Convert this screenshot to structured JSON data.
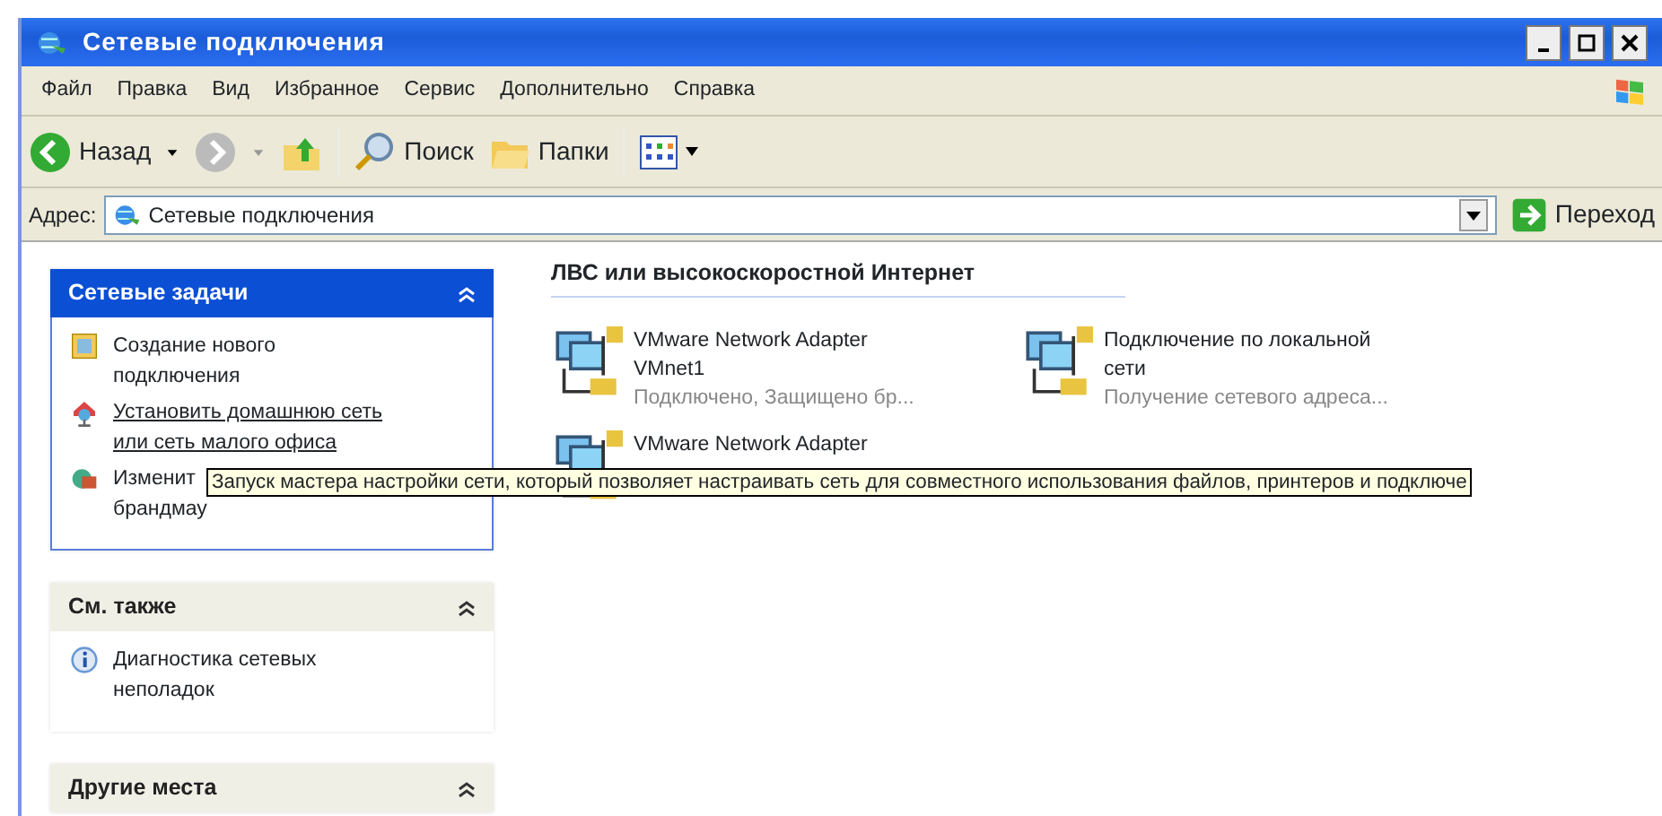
{
  "window": {
    "title": "Сетевые подключения"
  },
  "menu": [
    "Файл",
    "Правка",
    "Вид",
    "Избранное",
    "Сервис",
    "Дополнительно",
    "Справка"
  ],
  "toolbar": {
    "back": "Назад",
    "search": "Поиск",
    "folders": "Папки"
  },
  "address": {
    "label": "Адрес:",
    "value": "Сетевые подключения",
    "go": "Переход"
  },
  "task_panels": [
    {
      "title": "Сетевые задачи",
      "active": true,
      "items": [
        {
          "kind": "wizard",
          "lines": [
            "Создание нового",
            "подключения"
          ],
          "hovered": false
        },
        {
          "kind": "home",
          "lines": [
            "Установить домашнюю сеть",
            "или сеть малого офиса"
          ],
          "hovered": true
        },
        {
          "kind": "firewall",
          "lines": [
            "Изменит",
            "брандмау"
          ],
          "hovered": false
        }
      ]
    },
    {
      "title": "См. также",
      "active": false,
      "items": [
        {
          "kind": "info",
          "lines": [
            "Диагностика сетевых",
            "неполадок"
          ],
          "hovered": false
        }
      ]
    },
    {
      "title": "Другие места",
      "active": false
    }
  ],
  "group_title": "ЛВС или высокоскоростной Интернет",
  "connections": [
    {
      "name": [
        "VMware Network Adapter",
        "VMnet1"
      ],
      "status": "Подключено, Защищено бр..."
    },
    {
      "name": [
        "Подключение по локальной",
        "сети"
      ],
      "status": "Получение сетевого адреса..."
    },
    {
      "name": [
        "VMware Network Adapter"
      ]
    }
  ],
  "tooltip": "Запуск мастера настройки сети, который позволяет настраивать сеть для совместного использования файлов, принтеров и подключе"
}
